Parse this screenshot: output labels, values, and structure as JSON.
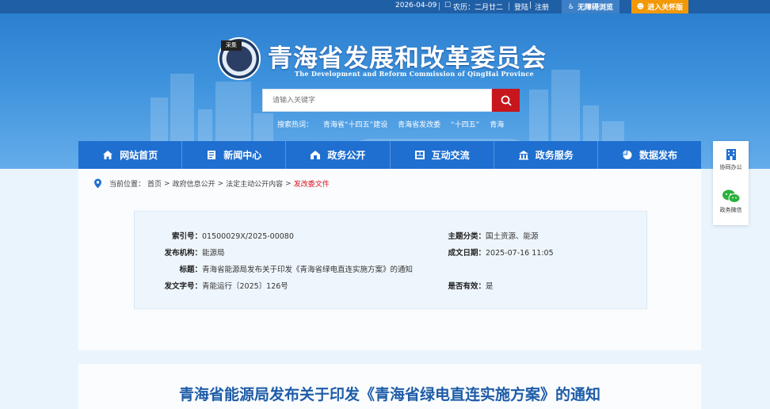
{
  "topbar": {
    "date": "2026-04-09",
    "lunar": "农历：二月廿二",
    "login": "登陆",
    "register": "注册",
    "accessibility": "无障碍浏览",
    "old_version": "进入关怀版"
  },
  "header": {
    "stamp": "采集",
    "title": "青海省发展和改革委员会",
    "subtitle": "The Development and Reform Commission of QingHai Province"
  },
  "search": {
    "placeholder": "请输入关键字",
    "hot_label": "搜索热词：",
    "hot_words": [
      "青海省“十四五”建设",
      "青海省发改委",
      "“十四五”",
      "青海"
    ]
  },
  "nav": {
    "items": [
      {
        "label": "网站首页",
        "icon": "home-icon"
      },
      {
        "label": "新闻中心",
        "icon": "news-icon"
      },
      {
        "label": "政务公开",
        "icon": "open-gov-icon"
      },
      {
        "label": "互动交流",
        "icon": "interaction-icon"
      },
      {
        "label": "政务服务",
        "icon": "service-icon"
      },
      {
        "label": "数据发布",
        "icon": "chart-pie-icon"
      }
    ]
  },
  "side": {
    "office": "协同办公",
    "wechat": "政务微信"
  },
  "breadcrumb": {
    "prefix": "当前位置：",
    "items": [
      "首页",
      "政府信息公开",
      "法定主动公开内容"
    ],
    "current": "发改委文件"
  },
  "meta": {
    "index_label": "索引号：",
    "index_value": "01500029X/2025-00080",
    "topic_label": "主题分类：",
    "topic_value": "国土资源、能源",
    "org_label": "发布机构：",
    "org_value": "能源局",
    "date_label": "成文日期：",
    "date_value": "2025-07-16 11:05",
    "title_label": "标题：",
    "title_value": "青海省能源局发布关于印发《青海省绿电直连实施方案》的通知",
    "docno_label": "发文字号：",
    "docno_value": "青能运行〔2025〕126号",
    "valid_label": "是否有效：",
    "valid_value": "是"
  },
  "document": {
    "title": "青海省能源局发布关于印发《青海省绿电直连实施方案》的通知"
  },
  "colors": {
    "topbar": "#1f5fa6",
    "nav": "#1e6fd0",
    "accent_red": "#c8161d",
    "old_btn": "#f39800",
    "doc_title": "#1e5ca8"
  }
}
